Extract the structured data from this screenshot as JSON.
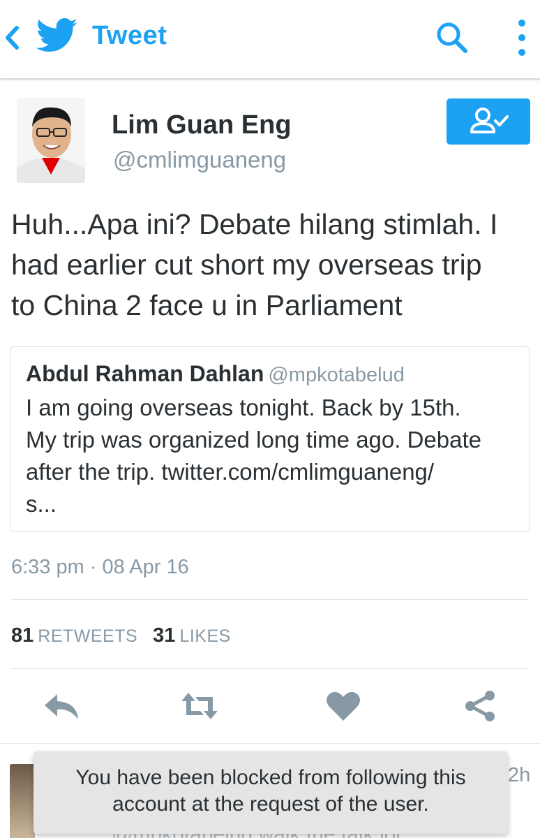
{
  "appbar": {
    "title": "Tweet",
    "icons": [
      "back-chevron-icon",
      "twitter-bird-icon",
      "search-icon",
      "more-vertical-icon"
    ],
    "accent_color": "#1da1f2"
  },
  "tweet": {
    "author": {
      "name": "Lim Guan Eng",
      "handle": "@cmlimguaneng",
      "following_icon": "user-check-icon"
    },
    "text_lines": [
      "Huh...Apa ini? Debate hilang stimlah. I",
      "had earlier cut short my overseas trip",
      "to China 2 face u in Parliament"
    ],
    "quote": {
      "name": "Abdul Rahman Dahlan",
      "handle": "@mpkotabelud",
      "text_lines": [
        "I am going overseas tonight. Back by 15th.",
        "My trip was organized long time ago. Debate",
        "after the trip.  twitter.com/cmlimguaneng/",
        "s..."
      ]
    },
    "timestamp": "6:33 pm · 08 Apr 16",
    "stats": {
      "retweets_count": "81",
      "retweets_label": "RETWEETS",
      "likes_count": "31",
      "likes_label": "LIKES"
    },
    "actions": [
      "reply-icon",
      "retweet-icon",
      "like-heart-icon",
      "share-icon"
    ]
  },
  "next_tweet": {
    "time": "2h",
    "text": "@mpkotabelud walk the talk lol"
  },
  "toast": {
    "line1": "You have been blocked from following this",
    "line2": "account at the request of the user."
  },
  "colors": {
    "primary_text": "#292f33",
    "secondary_text": "#8899a6",
    "icon_gray": "#8899a6",
    "toast_bg": "#e5e5e5"
  }
}
